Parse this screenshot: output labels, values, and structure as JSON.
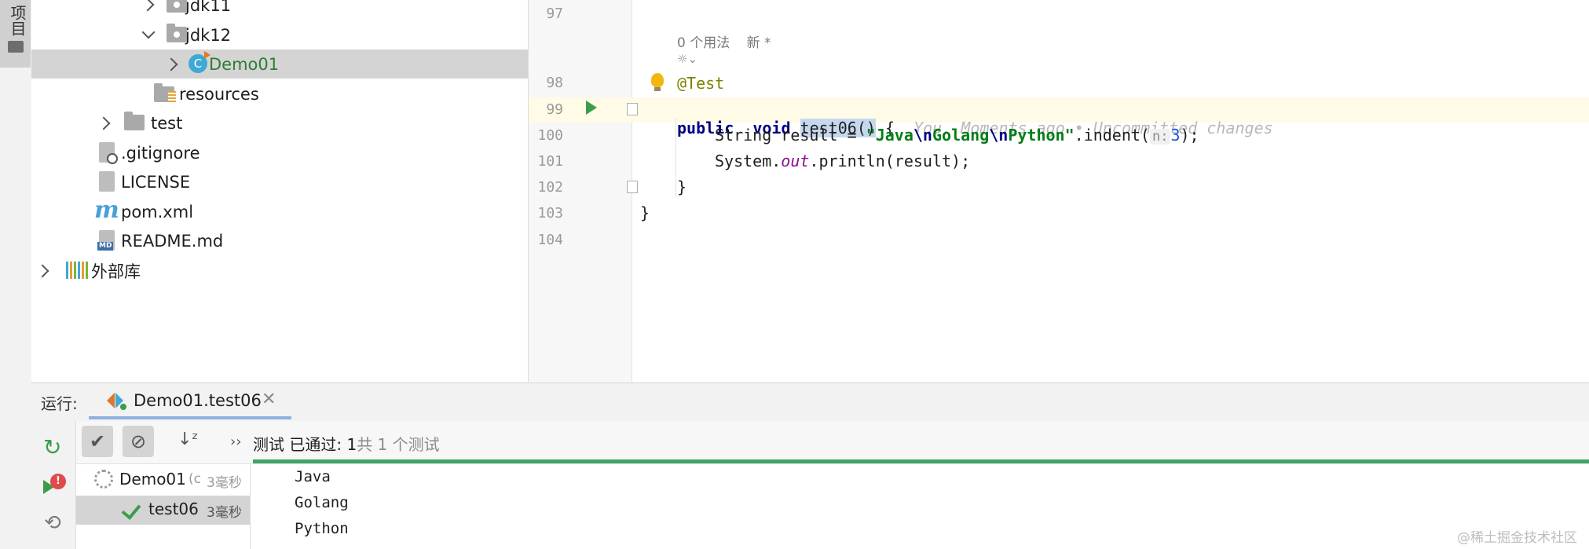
{
  "left_strip": {
    "project_tab": "项目"
  },
  "tree": {
    "items": [
      {
        "label": "jdk11",
        "kind": "package"
      },
      {
        "label": "jdk12",
        "kind": "package"
      },
      {
        "label": "Demo01",
        "kind": "class"
      },
      {
        "label": "resources",
        "kind": "resources-folder"
      },
      {
        "label": "test",
        "kind": "folder"
      },
      {
        "label": ".gitignore",
        "kind": "ignore-file"
      },
      {
        "label": "LICENSE",
        "kind": "text-file"
      },
      {
        "label": "pom.xml",
        "kind": "maven-file"
      },
      {
        "label": "README.md",
        "kind": "markdown-file"
      },
      {
        "label": "外部库",
        "kind": "external-libraries"
      }
    ]
  },
  "editor": {
    "line_numbers": [
      "97",
      "98",
      "99",
      "100",
      "101",
      "102",
      "103",
      "104"
    ],
    "usage_hint": "0 个用法",
    "new_label": "新 *",
    "annotation": "@Test",
    "line99": {
      "kw1": "public",
      "kw2": "void",
      "method_pre": "test06",
      "method_post": "()",
      "brace": " {",
      "blame": "You, Moments ago • Uncommitted changes"
    },
    "line100": {
      "type": "String",
      "rest1": " result = ",
      "str1": "\"Java",
      "esc1": "\\n",
      "str2": "Golang",
      "esc2": "\\n",
      "str3": "Python\"",
      "call": ".indent(",
      "hint": "n:",
      "num": "3",
      "end": ");"
    },
    "line101": {
      "pre": "System.",
      "field": "out",
      "post": ".println(result);"
    },
    "line102": "}",
    "line103": "}"
  },
  "run_panel": {
    "label": "运行:",
    "tab_title": "Demo01.test06",
    "status_prefix": "测试 已通过: 1",
    "status_suffix": "共 1 个测试",
    "tests": [
      {
        "name": "Demo01",
        "detail": "(c",
        "time": "3毫秒"
      },
      {
        "name": "test06",
        "time": "3毫秒"
      }
    ],
    "output": [
      "Java",
      "Golang",
      "Python"
    ],
    "rerun_failed_badge": "!"
  },
  "watermark": "@稀土掘金技术社区",
  "colors": {
    "accent_green": "#3ea566",
    "selection": "#d4d4d4",
    "keyword": "#000080",
    "string": "#067d17",
    "annotation": "#808000"
  }
}
